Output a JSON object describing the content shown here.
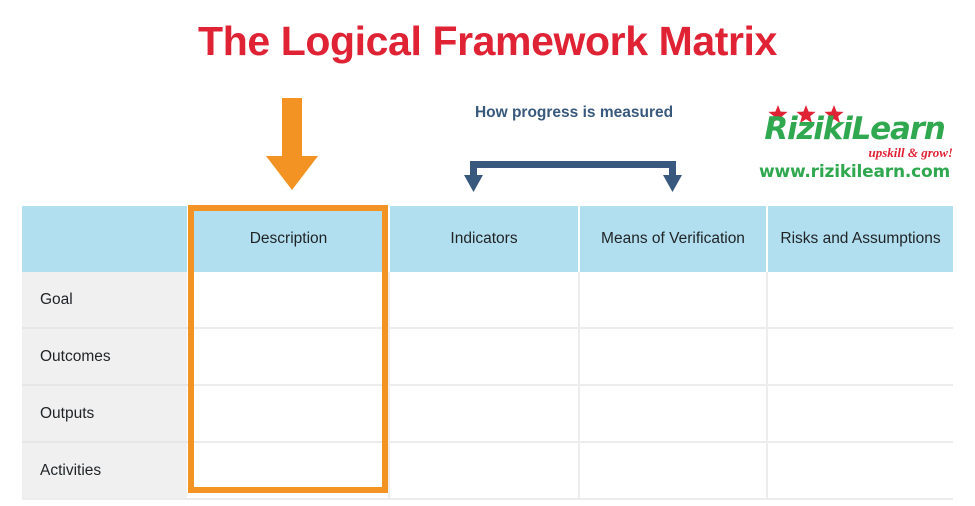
{
  "title": "The Logical Framework Matrix",
  "annotations": {
    "description_arrow": {
      "icon": "arrow-down-icon",
      "color": "#f29324"
    },
    "progress_note": {
      "label": "How progress is measured",
      "color": "#38597d",
      "icon": "bracket-double-arrow-down-icon"
    }
  },
  "logo": {
    "wordmark": "RizikiLearn",
    "tagline": "upskill & grow!",
    "url": "www.rizikilearn.com",
    "stars_icon": "three-stars-icon",
    "green": "#2fa84f",
    "red": "#e02235"
  },
  "matrix": {
    "corner_header": "",
    "columns": [
      "Description",
      "Indicators",
      "Means of Verification",
      "Risks and Assumptions"
    ],
    "rows": [
      {
        "label": "Goal",
        "cells": [
          "",
          "",
          "",
          ""
        ]
      },
      {
        "label": "Outcomes",
        "cells": [
          "",
          "",
          "",
          ""
        ]
      },
      {
        "label": "Outputs",
        "cells": [
          "",
          "",
          "",
          ""
        ]
      },
      {
        "label": "Activities",
        "cells": [
          "",
          "",
          "",
          ""
        ]
      }
    ],
    "highlighted_column": "Description",
    "colors": {
      "header_bg": "#b2dfef",
      "rowlabel_bg": "#f0f0f0",
      "highlight_border": "#f29324",
      "grid_line": "#ededed"
    }
  }
}
